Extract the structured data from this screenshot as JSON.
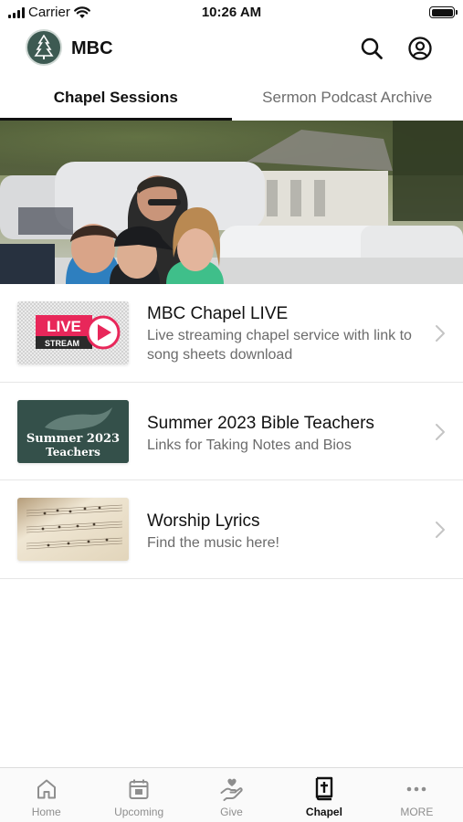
{
  "status_bar": {
    "carrier": "Carrier",
    "time": "10:26 AM"
  },
  "header": {
    "title": "MBC",
    "search_icon": "search-icon",
    "profile_icon": "account-circle-icon",
    "logo_icon": "tree-logo-icon"
  },
  "tabs": [
    {
      "label": "Chapel Sessions",
      "active": true
    },
    {
      "label": "Sermon Podcast Archive",
      "active": false
    }
  ],
  "hero": {
    "description_icon": "family-photo"
  },
  "items": [
    {
      "title": "MBC Chapel LIVE",
      "subtitle": "Live streaming chapel service with link to song sheets download",
      "thumb_text_1": "LIVE",
      "thumb_text_2": "STREAM"
    },
    {
      "title": "Summer 2023 Bible Teachers",
      "subtitle": "Links for Taking Notes and Bios",
      "thumb_text_1": "Summer 2023",
      "thumb_text_2": "Teachers"
    },
    {
      "title": "Worship Lyrics",
      "subtitle": "Find the music here!"
    }
  ],
  "tabbar": [
    {
      "label": "Home",
      "icon": "home-icon",
      "active": false
    },
    {
      "label": "Upcoming",
      "icon": "calendar-icon",
      "active": false
    },
    {
      "label": "Give",
      "icon": "give-hand-heart-icon",
      "active": false
    },
    {
      "label": "Chapel",
      "icon": "bible-cross-icon",
      "active": true
    },
    {
      "label": "MORE",
      "icon": "more-dots-icon",
      "active": false
    }
  ],
  "colors": {
    "accent": "#111111",
    "logo_bg": "#3d5a52",
    "live_red": "#e8275a",
    "teachers_bg": "#34504a"
  }
}
